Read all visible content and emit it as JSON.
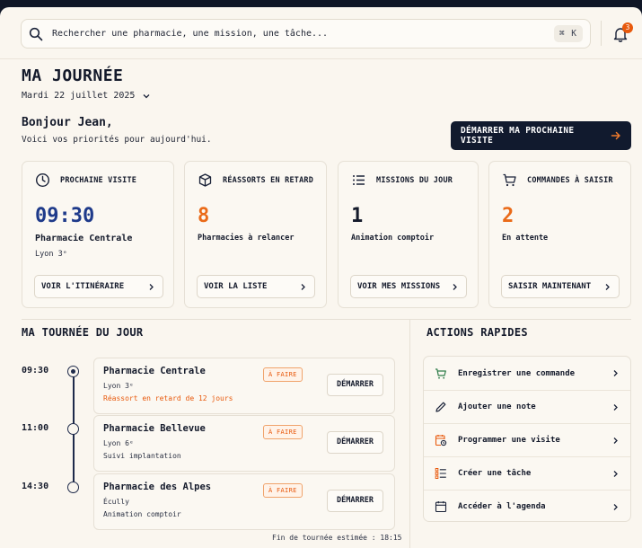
{
  "search": {
    "placeholder": "Rechercher une pharmacie, une mission, une tâche...",
    "shortcut": "⌘ K"
  },
  "notifications": {
    "count": "3"
  },
  "page": {
    "title": "MA JOURNÉE",
    "date": "Mardi 22 juillet 2025",
    "greeting": "Bonjour Jean,",
    "subtitle": "Voici vos priorités pour aujourd'hui.",
    "cta": "DÉMARRER MA PROCHAINE VISITE"
  },
  "cards": [
    {
      "label": "PROCHAINE VISITE",
      "value": "09:30",
      "line1": "Pharmacie Centrale",
      "line2": "Lyon 3ᵉ",
      "button": "VOIR L'ITINÉRAIRE",
      "icon": "clock-icon"
    },
    {
      "label": "RÉASSORTS EN RETARD",
      "value": "8",
      "line1": "Pharmacies à relancer",
      "button": "VOIR LA LISTE",
      "icon": "box-icon"
    },
    {
      "label": "MISSIONS DU JOUR",
      "value": "1",
      "line1": "Animation comptoir",
      "button": "VOIR MES MISSIONS",
      "icon": "list-icon"
    },
    {
      "label": "COMMANDES À SAISIR",
      "value": "2",
      "line1": "En attente",
      "button": "SAISIR MAINTENANT",
      "icon": "cart-icon"
    }
  ],
  "tour": {
    "title": "MA TOURNÉE DU JOUR",
    "visits": [
      {
        "time": "09:30",
        "name": "Pharmacie Centrale",
        "city": "Lyon 3ᵉ",
        "note": "Réassort en retard de 12 jours",
        "tag": "À FAIRE",
        "button": "DÉMARRER"
      },
      {
        "time": "11:00",
        "name": "Pharmacie Bellevue",
        "city": "Lyon 6ᵉ",
        "note": "Suivi implantation",
        "tag": "À FAIRE",
        "button": "DÉMARRER"
      },
      {
        "time": "14:30",
        "name": "Pharmacie des Alpes",
        "city": "Écully",
        "note": "Animation comptoir",
        "tag": "À FAIRE",
        "button": "DÉMARRER"
      }
    ],
    "end": "Fin de tournée estimée : 18:15"
  },
  "quick_actions": {
    "title": "ACTIONS RAPIDES",
    "items": [
      {
        "label": "Enregistrer une commande",
        "icon": "cart-icon"
      },
      {
        "label": "Ajouter une note",
        "icon": "pencil-icon"
      },
      {
        "label": "Programmer une visite",
        "icon": "calendar-clock-icon"
      },
      {
        "label": "Créer une tâche",
        "icon": "checklist-icon"
      },
      {
        "label": "Accéder à l'agenda",
        "icon": "calendar-icon"
      }
    ]
  },
  "colors": {
    "accent_orange": "#ea6a18",
    "accent_blue": "#1e3a8a",
    "green_icon": "#2f7d4a",
    "navy": "#111a2e"
  }
}
